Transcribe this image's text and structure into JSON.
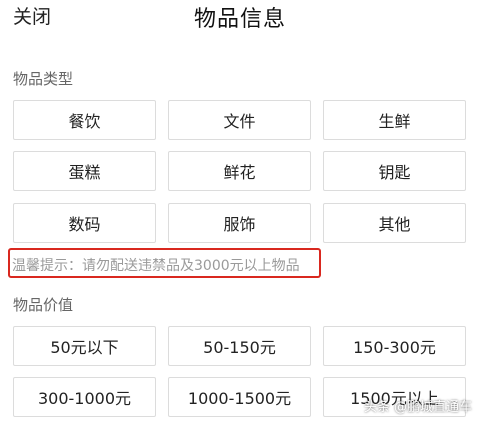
{
  "header": {
    "close_label": "关闭",
    "title": "物品信息"
  },
  "item_type": {
    "label": "物品类型",
    "options": [
      "餐饮",
      "文件",
      "生鲜",
      "蛋糕",
      "鲜花",
      "钥匙",
      "数码",
      "服饰",
      "其他"
    ]
  },
  "tip": {
    "text": "温馨提示：请勿配送违禁品及3000元以上物品",
    "highlight_color": "#d9281f"
  },
  "item_value": {
    "label": "物品价值",
    "options": [
      "50元以下",
      "50-150元",
      "150-300元",
      "300-1000元",
      "1000-1500元",
      "1500元以上"
    ]
  },
  "watermark": {
    "text": "头条 @鹏城直通车"
  }
}
